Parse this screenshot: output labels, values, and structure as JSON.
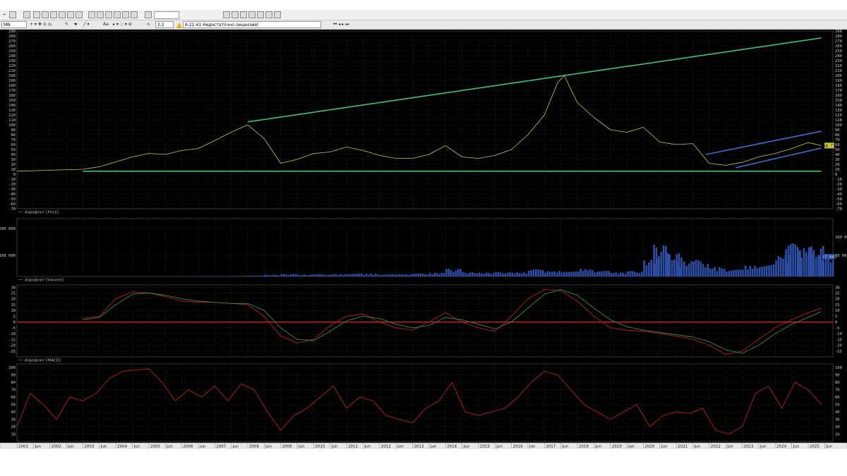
{
  "toolbar": {
    "timeframe": "MN",
    "font_label": "Aa",
    "scale_value": "2:2",
    "status_time": "6:21:41",
    "status_text": "Недостаточно лицензий!"
  },
  "chart_data": [
    {
      "type": "line",
      "pane": "price",
      "legend": "Аэрофлот [Price]",
      "ylim": [
        -70,
        290
      ],
      "y_ticks": [
        290,
        280,
        270,
        260,
        250,
        240,
        230,
        220,
        210,
        200,
        190,
        180,
        170,
        160,
        150,
        140,
        130,
        120,
        110,
        100,
        90,
        80,
        70,
        60,
        50,
        40,
        30,
        20,
        10,
        0,
        -10,
        -20,
        -30,
        -40,
        -50,
        -60,
        -70
      ],
      "x": [
        2001.0,
        2002.0,
        2003.0,
        2003.5,
        2004.0,
        2004.5,
        2005.0,
        2005.5,
        2006.0,
        2006.5,
        2007.0,
        2007.5,
        2008.0,
        2008.5,
        2009.0,
        2009.5,
        2010.0,
        2010.5,
        2011.0,
        2011.5,
        2012.0,
        2012.5,
        2013.0,
        2013.5,
        2014.0,
        2014.5,
        2015.0,
        2015.5,
        2016.0,
        2016.5,
        2017.0,
        2017.4,
        2017.6,
        2018.0,
        2018.5,
        2019.0,
        2019.5,
        2020.0,
        2020.5,
        2021.0,
        2021.5,
        2022.0,
        2022.5,
        2023.0,
        2023.5,
        2024.0,
        2024.5,
        2025.0,
        2025.4
      ],
      "values": [
        6,
        8,
        10,
        15,
        25,
        35,
        42,
        40,
        48,
        52,
        68,
        85,
        100,
        72,
        22,
        30,
        42,
        45,
        55,
        48,
        38,
        32,
        32,
        40,
        58,
        35,
        32,
        38,
        50,
        80,
        120,
        185,
        200,
        145,
        115,
        90,
        85,
        95,
        65,
        60,
        62,
        22,
        18,
        24,
        35,
        42,
        52,
        64,
        58
      ],
      "last_value": "58.73",
      "series_color": "#c9c942",
      "trendlines": [
        {
          "x": [
            2008.0,
            2025.4
          ],
          "y": [
            106,
            276
          ],
          "color": "#3fc27a"
        },
        {
          "x": [
            2003.0,
            2025.4
          ],
          "y": [
            6,
            6
          ],
          "color": "#3fc27a"
        },
        {
          "x": [
            2021.9,
            2025.4
          ],
          "y": [
            40,
            87
          ],
          "color": "#3a6fd6"
        },
        {
          "x": [
            2022.8,
            2025.4
          ],
          "y": [
            13,
            53
          ],
          "color": "#3a6fd6"
        }
      ]
    },
    {
      "type": "bar",
      "pane": "volume",
      "legend": "Аэрофлот [Volume]",
      "y_ticks_left": [
        "200 000",
        "100 000"
      ],
      "y_ticks_right": [
        "100 000",
        "50 000"
      ],
      "ylim": [
        0,
        210000
      ],
      "last_value": "27 893",
      "series_color": "#2d4fa8",
      "x": [
        2006.0,
        2006.5,
        2007.0,
        2007.5,
        2008.0,
        2008.5,
        2009.0,
        2009.5,
        2010.0,
        2010.5,
        2011.0,
        2011.5,
        2012.0,
        2012.5,
        2013.0,
        2013.5,
        2014.0,
        2014.5,
        2015.0,
        2015.5,
        2016.0,
        2016.5,
        2017.0,
        2017.5,
        2018.0,
        2018.5,
        2019.0,
        2019.5,
        2020.0,
        2020.3,
        2020.7,
        2021.0,
        2021.5,
        2022.0,
        2022.5,
        2023.0,
        2023.5,
        2024.0,
        2024.3,
        2024.7,
        2025.0,
        2025.3
      ],
      "values": [
        1000,
        1500,
        1500,
        2000,
        3000,
        6000,
        9000,
        7000,
        8000,
        9000,
        11000,
        10000,
        9000,
        9000,
        11000,
        14000,
        28000,
        16000,
        14000,
        16000,
        15000,
        26000,
        20000,
        25000,
        28000,
        20000,
        15000,
        20000,
        60000,
        115000,
        85000,
        55000,
        60000,
        35000,
        25000,
        40000,
        55000,
        80000,
        120000,
        105000,
        110000,
        75000
      ]
    },
    {
      "type": "line",
      "pane": "macd",
      "legend": "Аэрофлот [MACD]",
      "ylim": [
        -30,
        32
      ],
      "y_ticks": [
        30,
        25,
        20,
        15,
        10,
        5,
        0,
        -5,
        -10,
        -15,
        -20,
        -25
      ],
      "x": [
        2003.0,
        2003.5,
        2004.0,
        2004.5,
        2005.0,
        2005.5,
        2006.0,
        2006.5,
        2007.0,
        2007.5,
        2008.0,
        2008.5,
        2009.0,
        2009.5,
        2010.0,
        2010.5,
        2011.0,
        2011.5,
        2012.0,
        2012.5,
        2013.0,
        2013.5,
        2014.0,
        2014.5,
        2015.0,
        2015.5,
        2016.0,
        2016.5,
        2017.0,
        2017.5,
        2018.0,
        2018.5,
        2019.0,
        2019.5,
        2020.0,
        2020.5,
        2021.0,
        2021.5,
        2022.0,
        2022.5,
        2023.0,
        2023.5,
        2024.0,
        2024.5,
        2025.0,
        2025.4
      ],
      "series": [
        {
          "values": [
            3,
            5,
            20,
            26,
            25,
            22,
            18,
            17,
            17,
            16,
            15,
            5,
            -12,
            -18,
            -15,
            -3,
            5,
            7,
            0,
            -5,
            -7,
            0,
            8,
            0,
            -5,
            -8,
            5,
            20,
            28,
            27,
            18,
            5,
            -5,
            -7,
            -8,
            -10,
            -12,
            -15,
            -20,
            -28,
            -25,
            -15,
            -5,
            2,
            8,
            12
          ],
          "color": "#b81f1f"
        },
        {
          "values": [
            2,
            4,
            15,
            24,
            25,
            23,
            20,
            18,
            17,
            16,
            16,
            10,
            -5,
            -15,
            -16,
            -8,
            1,
            5,
            3,
            -2,
            -5,
            -3,
            4,
            2,
            -2,
            -6,
            0,
            12,
            24,
            28,
            23,
            12,
            2,
            -4,
            -7,
            -9,
            -11,
            -13,
            -17,
            -24,
            -27,
            -20,
            -10,
            -2,
            4,
            9
          ],
          "color": "#3f8a3f"
        }
      ],
      "zero_line": 0,
      "zero_color": "#d42020"
    },
    {
      "type": "line",
      "pane": "rsi",
      "legend": "Аэрофлот [RSI]",
      "ylim": [
        0,
        105
      ],
      "y_ticks": [
        100,
        90,
        80,
        70,
        60,
        50,
        40,
        30,
        20,
        10
      ],
      "x_ticks": [
        "2001",
        "Jun",
        "2002",
        "Jun",
        "2003",
        "Jun",
        "2004",
        "Jun",
        "2005",
        "Jun",
        "2006",
        "Jun",
        "2007",
        "Jun",
        "2008",
        "Jun",
        "2009",
        "Jun",
        "2010",
        "Jun",
        "2011",
        "Jun",
        "2012",
        "Jun",
        "2013",
        "Jun",
        "2014",
        "Jun",
        "2015",
        "Jun",
        "2016",
        "Jun",
        "2017",
        "Jun",
        "2018",
        "Jun",
        "2019",
        "Jun",
        "2020",
        "Jun",
        "2021",
        "Jun",
        "2022",
        "Jun",
        "2023",
        "Jun",
        "2024",
        "Jun",
        "2025",
        "Jun"
      ],
      "x": [
        2001.0,
        2001.4,
        2001.8,
        2002.2,
        2002.6,
        2003.0,
        2003.4,
        2003.8,
        2004.2,
        2004.6,
        2005.0,
        2005.4,
        2005.8,
        2006.2,
        2006.6,
        2007.0,
        2007.4,
        2007.8,
        2008.2,
        2008.6,
        2009.0,
        2009.4,
        2009.8,
        2010.2,
        2010.6,
        2011.0,
        2011.4,
        2011.8,
        2012.2,
        2012.6,
        2013.0,
        2013.4,
        2013.8,
        2014.2,
        2014.6,
        2015.0,
        2015.4,
        2015.8,
        2016.2,
        2016.6,
        2017.0,
        2017.4,
        2017.8,
        2018.2,
        2018.6,
        2019.0,
        2019.4,
        2019.8,
        2020.2,
        2020.6,
        2021.0,
        2021.4,
        2021.8,
        2022.2,
        2022.6,
        2023.0,
        2023.4,
        2023.8,
        2024.2,
        2024.6,
        2025.0,
        2025.4
      ],
      "values": [
        20,
        65,
        50,
        30,
        60,
        55,
        65,
        85,
        95,
        97,
        98,
        80,
        55,
        70,
        60,
        75,
        55,
        78,
        70,
        40,
        15,
        35,
        45,
        60,
        75,
        45,
        60,
        55,
        35,
        30,
        25,
        45,
        55,
        80,
        40,
        35,
        40,
        45,
        60,
        80,
        95,
        90,
        70,
        50,
        40,
        30,
        40,
        50,
        20,
        35,
        40,
        38,
        45,
        15,
        10,
        20,
        65,
        75,
        45,
        80,
        70,
        50
      ],
      "color": "#b81f1f"
    }
  ]
}
